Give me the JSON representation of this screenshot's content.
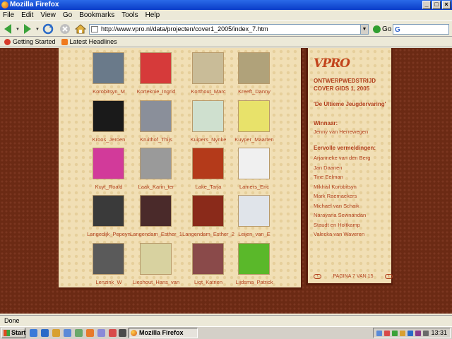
{
  "window": {
    "title": "Mozilla Firefox"
  },
  "menu": [
    "File",
    "Edit",
    "View",
    "Go",
    "Bookmarks",
    "Tools",
    "Help"
  ],
  "address": {
    "url": "http://www.vpro.nl/data/projecten/cover1_2005/index_7.htm"
  },
  "go_label": "Go",
  "search": {
    "engine": "G"
  },
  "bookmarks": [
    "Getting Started",
    "Latest Headlines"
  ],
  "gallery": {
    "items": [
      {
        "label": "Korobitsyn_M",
        "color": "#6a7a8a"
      },
      {
        "label": "Korteknie_Ingrid",
        "color": "#d63a3a"
      },
      {
        "label": "Korthout_Marc",
        "color": "#c9bc98"
      },
      {
        "label": "Kreeft_Danny",
        "color": "#b0a27a"
      },
      {
        "label": "Kroos_Jeroen",
        "color": "#1a1a1a"
      },
      {
        "label": "Kruithof_Thijs",
        "color": "#8a8f9a"
      },
      {
        "label": "Kuipers_Nynke",
        "color": "#cfe0cf"
      },
      {
        "label": "Kuyper_Maarten",
        "color": "#e8e26a"
      },
      {
        "label": "Kuyt_Roald",
        "color": "#d23a9a"
      },
      {
        "label": "Laak_Karin_ter",
        "color": "#9a9a9a"
      },
      {
        "label": "Lake_Tarja",
        "color": "#b43a1a"
      },
      {
        "label": "Lamers_Eric",
        "color": "#f0f0f0"
      },
      {
        "label": "Langedijk_Pepeyn",
        "color": "#3a3a3a"
      },
      {
        "label": "Langendam_Esther_1",
        "color": "#4a2a2a"
      },
      {
        "label": "Langendam_Esther_2",
        "color": "#8a2a1a"
      },
      {
        "label": "Leijen_van_E",
        "color": "#e0e4ea"
      },
      {
        "label": "Lenzink_W",
        "color": "#5a5a5a"
      },
      {
        "label": "Lieshout_Hans_van",
        "color": "#d8d2a0"
      },
      {
        "label": "Ligt_Katrien",
        "color": "#8a4a4a"
      },
      {
        "label": "Lijdsma_Patrick",
        "color": "#5ab82a"
      }
    ]
  },
  "side": {
    "logo": "VPRO",
    "title1": "ONTWERPWEDSTRIJD",
    "title2": "COVER GIDS 1, 2005",
    "subtitle": "'De Ultieme Jeugdervaring'",
    "winner_heading": "Winnaar:",
    "winner": "Jenny van Herrewegen",
    "mentions_heading": "Eervolle vermeldingen:",
    "mentions": [
      "Arjanneke van den Berg",
      "Jan Daanen",
      "Tine Eelman",
      "Mikhail Korobitsyn",
      "Mark Raemaekers",
      "Michael van Schaik",
      "Narayana Sewnandan",
      "Staudt en Holtkamp",
      "Valecka van Waveren"
    ],
    "pagina": "PAGINA 7 VAN 15"
  },
  "status": {
    "text": "Done"
  },
  "taskbar": {
    "start": "Start",
    "item": "Mozilla Firefox",
    "clock": "13:31"
  }
}
